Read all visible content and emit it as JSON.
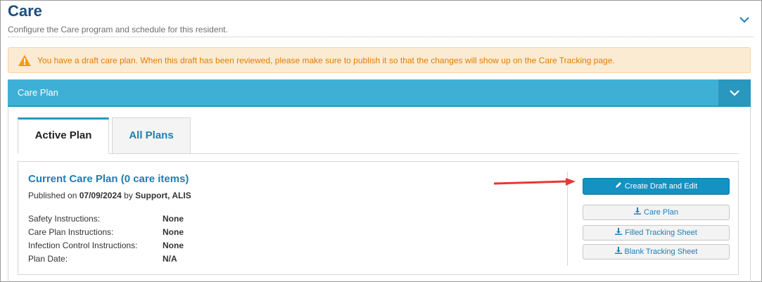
{
  "header": {
    "title": "Care",
    "subtitle": "Configure the Care program and schedule for this resident."
  },
  "alert": {
    "message": "You have a draft care plan. When this draft has been reviewed, please make sure to publish it so that the changes will show up on the Care Tracking page."
  },
  "panel": {
    "title": "Care Plan"
  },
  "tabs": [
    {
      "label": "Active Plan",
      "active": true
    },
    {
      "label": "All Plans",
      "active": false
    }
  ],
  "plan": {
    "title": "Current Care Plan (0 care items)",
    "published_prefix": "Published on",
    "published_date": "07/09/2024",
    "published_by_word": "by",
    "published_by": "Support, ALIS",
    "details": [
      {
        "label": "Safety Instructions:",
        "value": "None"
      },
      {
        "label": "Care Plan Instructions:",
        "value": "None"
      },
      {
        "label": "Infection Control Instructions:",
        "value": "None"
      },
      {
        "label": "Plan Date:",
        "value": "N/A"
      }
    ]
  },
  "actions": {
    "create_draft": "Create Draft and Edit",
    "care_plan": "Care Plan",
    "filled_sheet": "Filled Tracking Sheet",
    "blank_sheet": "Blank Tracking Sheet"
  },
  "colors": {
    "title": "#1e4e7c",
    "accent": "#3fb0d5",
    "alert_text": "#e07d00",
    "alert_bg": "#fcebd3",
    "primary_button": "#1591c4",
    "annotation_arrow": "#e53935"
  }
}
